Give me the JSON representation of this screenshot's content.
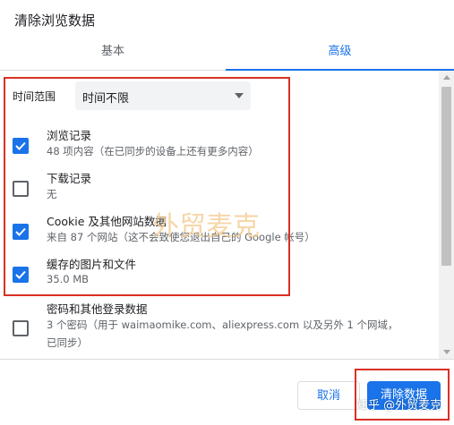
{
  "dialog": {
    "title": "清除浏览数据"
  },
  "tabs": [
    {
      "label": "基本",
      "active": false
    },
    {
      "label": "高级",
      "active": true
    }
  ],
  "time_range": {
    "label": "时间范围",
    "selected": "时间不限"
  },
  "items": [
    {
      "title": "浏览记录",
      "description": "48 项内容（在已同步的设备上还有更多内容）",
      "checked": true
    },
    {
      "title": "下载记录",
      "description": "无",
      "checked": false
    },
    {
      "title": "Cookie 及其他网站数据",
      "description": "来自 87 个网站（这不会致使您退出自己的 Google 帐号）",
      "checked": true
    },
    {
      "title": "缓存的图片和文件",
      "description": "35.0 MB",
      "checked": true
    },
    {
      "title": "密码和其他登录数据",
      "description": "3 个密码（用于 waimaomike.com、aliexpress.com 以及另外 1 个网域，",
      "description2": "已同步）",
      "checked": false
    }
  ],
  "buttons": {
    "cancel": "取消",
    "clear": "清除数据"
  },
  "watermark": "外贸麦克",
  "credit": "知乎 @外贸麦克",
  "colors": {
    "accent": "#1a73e8",
    "annotation": "#d93025"
  }
}
